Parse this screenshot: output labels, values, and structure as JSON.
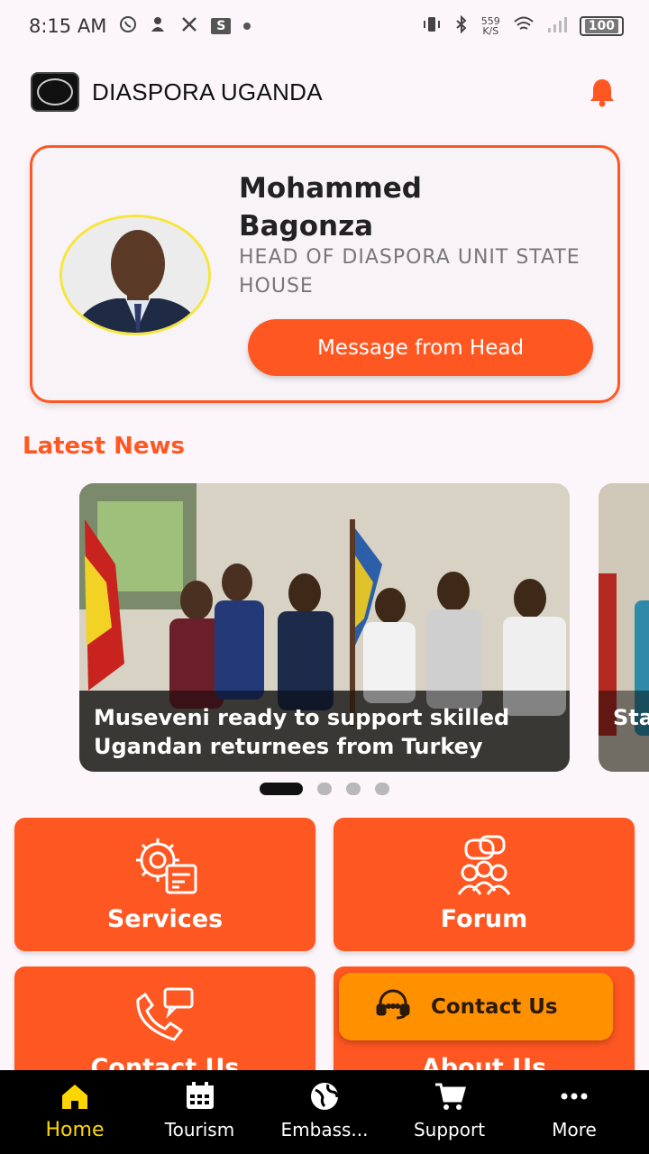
{
  "status_bar": {
    "time": "8:15 AM",
    "net_speed_value": "559",
    "net_speed_unit": "K/S",
    "battery": "100",
    "notif_box": "S"
  },
  "header": {
    "title": "DIASPORA UGANDA"
  },
  "head_card": {
    "name": "Mohammed Bagonza",
    "role": "HEAD OF DIASPORA UNIT STATE HOUSE",
    "button_label": "Message from Head"
  },
  "news": {
    "section_title": "Latest News",
    "items": [
      {
        "caption": "Museveni ready to support skilled Ugandan returnees from Turkey"
      },
      {
        "caption": "Sta dis"
      }
    ],
    "active_index": 0,
    "total_pages": 4
  },
  "tiles": [
    {
      "label": "Services",
      "icon": "services-gear-icon"
    },
    {
      "label": "Forum",
      "icon": "forum-people-icon"
    },
    {
      "label": "Contact Us",
      "icon": "phone-chat-icon"
    },
    {
      "label": "About Us",
      "icon": ""
    }
  ],
  "contact_fab": {
    "label": "Contact Us",
    "icon": "headset-icon"
  },
  "bottom_nav": {
    "items": [
      {
        "label": "Home",
        "icon": "home-icon"
      },
      {
        "label": "Tourism",
        "icon": "calendar-icon"
      },
      {
        "label": "Embass...",
        "icon": "globe-icon"
      },
      {
        "label": "Support",
        "icon": "cart-icon"
      },
      {
        "label": "More",
        "icon": "more-dots-icon"
      }
    ],
    "active_index": 0
  },
  "colors": {
    "accent": "#ff5722",
    "fab": "#ff9100",
    "active_nav": "#ffd600",
    "background": "#fcf6fb"
  }
}
